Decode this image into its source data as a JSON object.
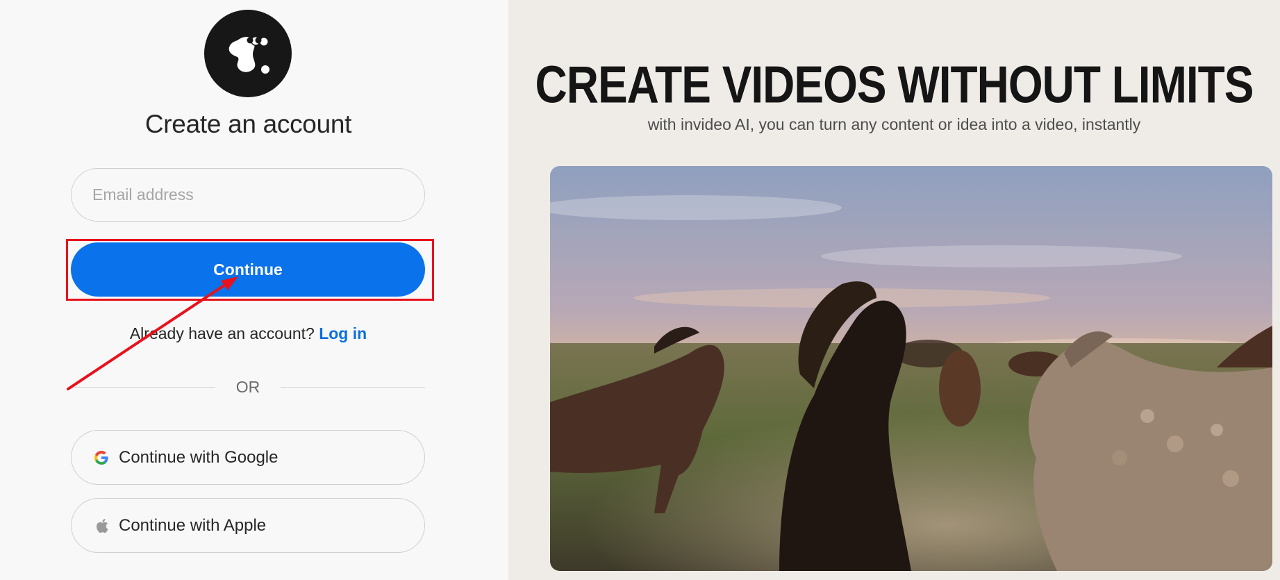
{
  "signup": {
    "logo": "invideo-logo",
    "title": "Create an account",
    "email_placeholder": "Email address",
    "email_value": "",
    "continue_label": "Continue",
    "login_prompt": "Already have an account?",
    "login_link": "Log in",
    "divider_text": "OR",
    "google_label": "Continue with Google",
    "apple_label": "Continue with Apple"
  },
  "hero": {
    "headline": "CREATE VIDEOS WITHOUT LIMITS",
    "subheadline": "with invideo AI, you can turn any content or idea into a video, instantly"
  },
  "colors": {
    "primary": "#0a72ea",
    "link": "#0a6fdf",
    "annotation": "#e8121c"
  }
}
